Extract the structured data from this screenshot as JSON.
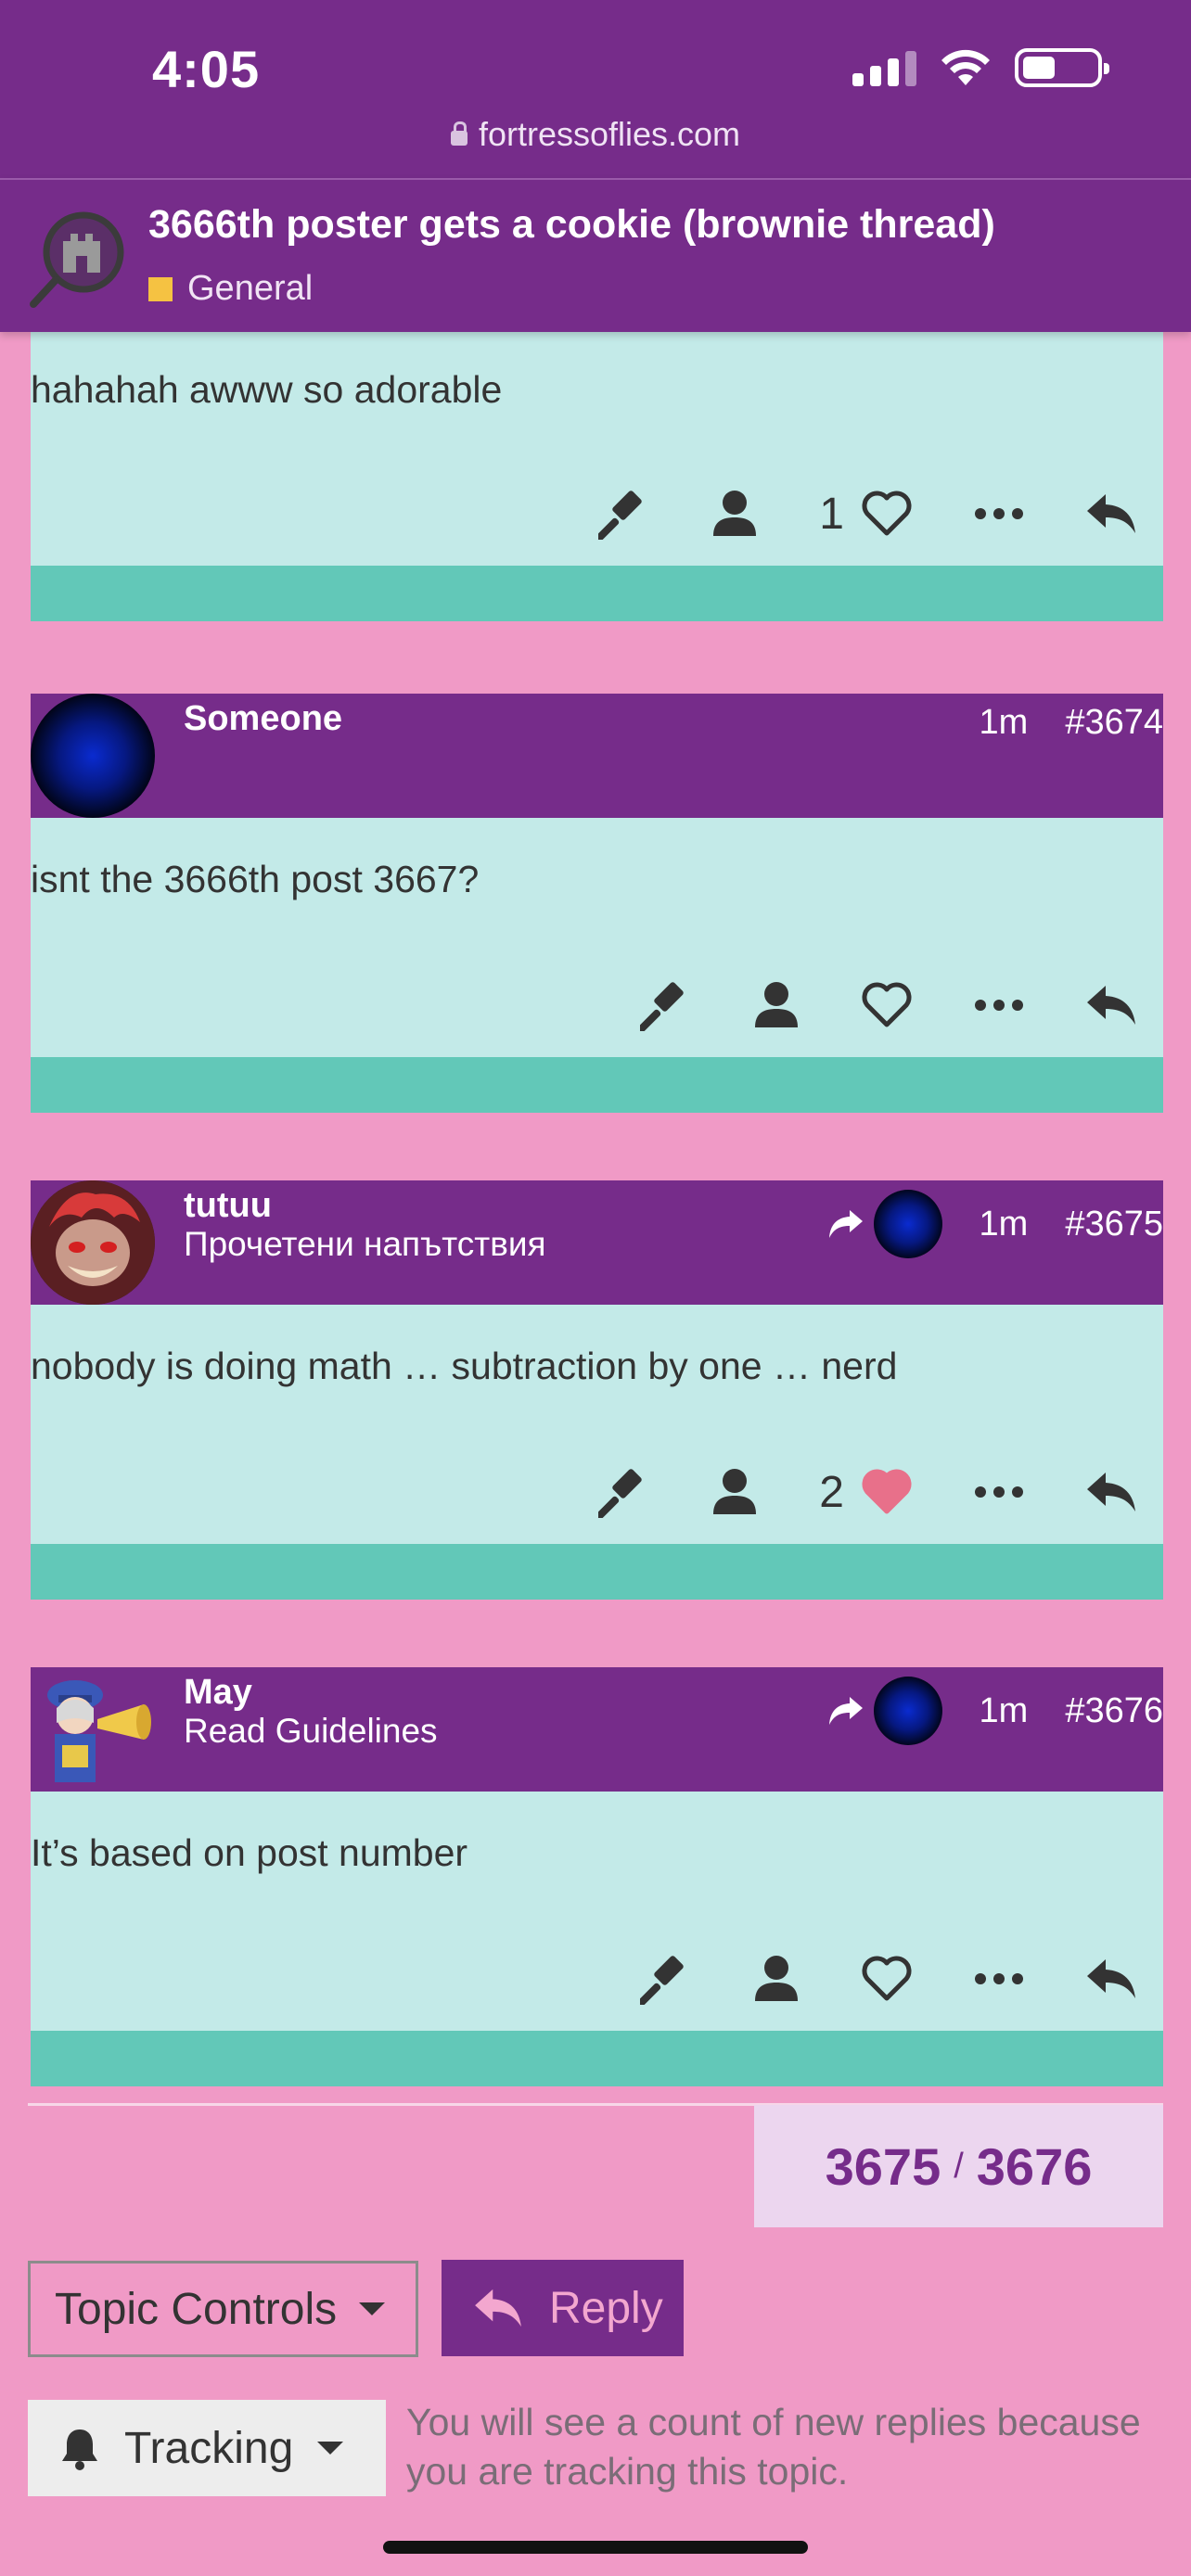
{
  "status_bar": {
    "time": "4:05",
    "url": "fortressoflies.com"
  },
  "topic": {
    "title": "3666th poster gets a cookie (brownie thread)",
    "category": "General",
    "category_color": "#f5c242"
  },
  "colors": {
    "purple": "#762c8a",
    "pink_bg": "#f09ac6",
    "post_body": "#c3eae8",
    "post_foot": "#62c8b8",
    "like_red": "#e8708a"
  },
  "posts": [
    {
      "body": "hahahah awww so adorable",
      "like_count": "1",
      "liked": false
    },
    {
      "username": "Someone",
      "user_title": "",
      "time": "1m",
      "post_number": "#3674",
      "body": "isnt the 3666th post 3667?",
      "like_count": "",
      "liked": false
    },
    {
      "username": "tutuu",
      "user_title": "Прочетени напътствия",
      "time": "1m",
      "post_number": "#3675",
      "body": "nobody is doing math … subtraction by one … nerd",
      "like_count": "2",
      "liked": true
    },
    {
      "username": "May",
      "user_title": "Read Guidelines",
      "time": "1m",
      "post_number": "#3676",
      "body": "It’s based on post number",
      "like_count": "",
      "liked": false
    }
  ],
  "progress": {
    "current": "3675",
    "separator": "/",
    "total": "3676"
  },
  "controls": {
    "topic_controls_label": "Topic Controls",
    "reply_label": "Reply",
    "tracking_label": "Tracking",
    "tracking_note": "You will see a count of new replies because you are tracking this topic."
  },
  "icons": [
    "lock-icon",
    "signal-icon",
    "wifi-icon",
    "battery-icon",
    "gavel-icon",
    "user-icon",
    "heart-icon",
    "more-icon",
    "reply-icon",
    "share-icon",
    "bell-icon",
    "chevron-down-icon"
  ]
}
